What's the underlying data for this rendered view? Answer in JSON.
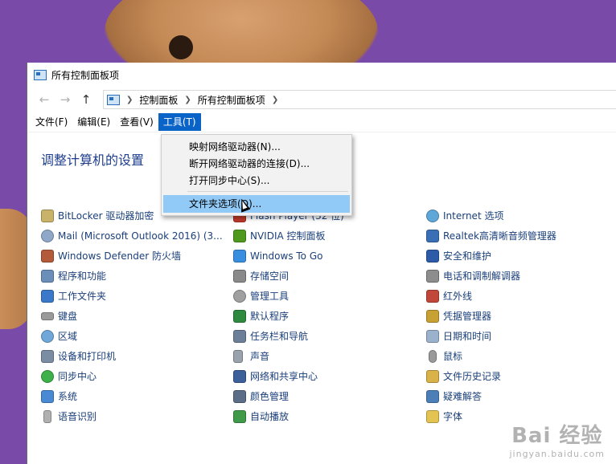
{
  "window": {
    "title": "所有控制面板项"
  },
  "nav": {
    "breadcrumb": [
      "控制面板",
      "所有控制面板项"
    ]
  },
  "menubar": {
    "file": "文件(F)",
    "edit": "编辑(E)",
    "view": "查看(V)",
    "tools": "工具(T)"
  },
  "page": {
    "heading": "调整计算机的设置"
  },
  "tools_menu": {
    "items": [
      "映射网络驱动器(N)...",
      "断开网络驱动器的连接(D)...",
      "打开同步中心(S)...",
      "文件夹选项(O)..."
    ],
    "highlighted": "文件夹选项(O)..."
  },
  "items": {
    "col1": [
      "BitLocker 驱动器加密",
      "Mail (Microsoft Outlook 2016) (3...",
      "Windows Defender 防火墙",
      "程序和功能",
      "工作文件夹",
      "键盘",
      "区域",
      "设备和打印机",
      "同步中心",
      "系统",
      "语音识别"
    ],
    "col2": [
      "Flash Player (32 位)",
      "NVIDIA 控制面板",
      "Windows To Go",
      "存储空间",
      "管理工具",
      "默认程序",
      "任务栏和导航",
      "声音",
      "网络和共享中心",
      "颜色管理",
      "自动播放"
    ],
    "col3": [
      "Internet 选项",
      "Realtek高清晰音频管理器",
      "安全和维护",
      "电话和调制解调器",
      "红外线",
      "凭据管理器",
      "日期和时间",
      "鼠标",
      "文件历史记录",
      "疑难解答",
      "字体"
    ]
  },
  "watermark": {
    "title": "Bai 经验",
    "sub": "jingyan.baidu.com"
  }
}
